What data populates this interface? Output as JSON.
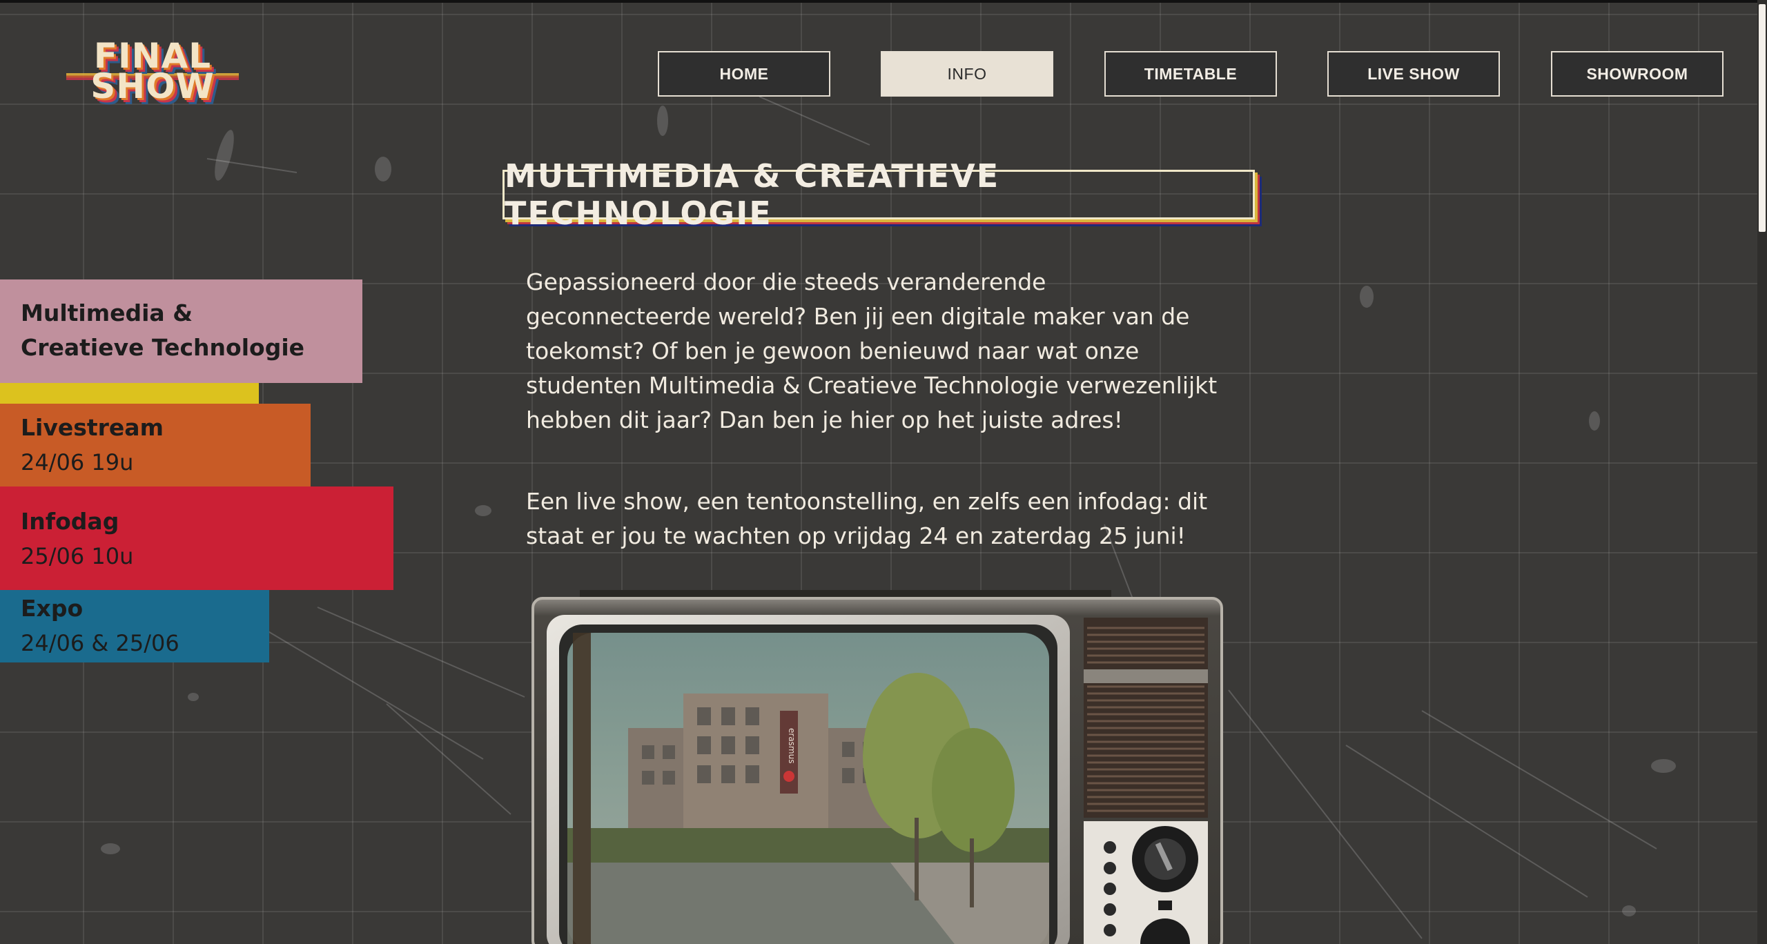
{
  "logo": {
    "line1": "FINAL",
    "line2": "SHOW"
  },
  "nav": {
    "items": [
      {
        "label": "HOME",
        "active": false
      },
      {
        "label": "INFO",
        "active": true
      },
      {
        "label": "TIMETABLE",
        "active": false
      },
      {
        "label": "LIVE SHOW",
        "active": false
      },
      {
        "label": "SHOWROOM",
        "active": false
      }
    ]
  },
  "page": {
    "title": "MULTIMEDIA & CREATIEVE TECHNOLOGIE",
    "paragraphs": [
      "Gepassioneerd door die steeds veranderende geconnecteerde wereld? Ben jij een digitale maker van de toekomst? Of ben je gewoon benieuwd naar wat onze studenten Multimedia & Creatieve Technologie verwezenlijkt hebben dit jaar? Dan ben je hier op het juiste adres!",
      "Een live show, een tentoonstelling, en zelfs een infodag: dit staat er jou te wachten op vrijdag 24 en zaterdag 25 juni!"
    ]
  },
  "sidebar": {
    "program": {
      "line1": "Multimedia &",
      "line2": "Creatieve Technologie"
    },
    "events": [
      {
        "title": "Livestream",
        "date": "24/06 19u"
      },
      {
        "title": "Infodag",
        "date": "25/06 10u"
      },
      {
        "title": "Expo",
        "date": "24/06 & 25/06"
      }
    ]
  },
  "tv_image": {
    "building_sign": "erasmus"
  },
  "colors": {
    "background": "#3a3937",
    "program_tab": "#c0909d",
    "yellow_bar": "#dcc21e",
    "livestream_tab": "#c85b26",
    "infodag_tab": "#cb2035",
    "expo_tab": "#1a6b8e",
    "nav_active": "#e8e1d5"
  }
}
